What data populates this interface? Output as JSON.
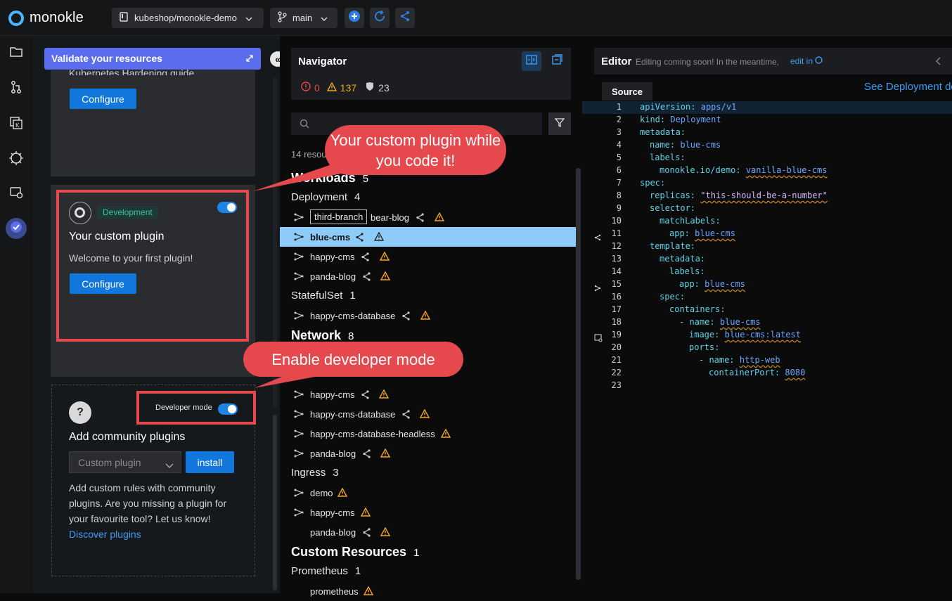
{
  "app": {
    "name": "monokle"
  },
  "topbar": {
    "repo": "kubeshop/monokle-demo",
    "branch": "main"
  },
  "validation": {
    "header": "Validate your resources",
    "card1": {
      "hardening_text": "Kubernetes Hardening guide.",
      "configure_label": "Configure"
    },
    "card2": {
      "badge": "Development",
      "title": "Your custom plugin",
      "description": "Welcome to your first plugin!",
      "configure_label": "Configure"
    },
    "community": {
      "dev_mode_label": "Developer mode",
      "title": "Add community plugins",
      "select_placeholder": "Custom plugin",
      "install_label": "install",
      "description": "Add custom rules with community plugins. Are you missing a plugin for your favourite tool? Let us know!",
      "discover_link": "Discover plugins"
    }
  },
  "navigator": {
    "title": "Navigator",
    "stats": {
      "errors": "0",
      "warnings": "137",
      "policies": "23"
    },
    "resource_count": "14 resources",
    "groups": {
      "workloads": {
        "name": "Workloads",
        "count": "5"
      },
      "network": {
        "name": "Network",
        "count": "8"
      },
      "custom": {
        "name": "Custom Resources",
        "count": "1"
      }
    },
    "kinds": {
      "deployment": {
        "name": "Deployment",
        "count": "4"
      },
      "statefulset": {
        "name": "StatefulSet",
        "count": "1"
      },
      "ingress": {
        "name": "Ingress",
        "count": "3"
      },
      "prometheus": {
        "name": "Prometheus",
        "count": "1"
      }
    },
    "deployment_items": {
      "branch_tag": "third-branch",
      "bear_blog": "bear-blog",
      "blue_cms": "blue-cms",
      "happy_cms": "happy-cms",
      "panda_blog": "panda-blog"
    },
    "statefulset_items": {
      "db": "happy-cms-database"
    },
    "network_items": {
      "happy_cms": "happy-cms",
      "db": "happy-cms-database",
      "db_headless": "happy-cms-database-headless",
      "panda_blog": "panda-blog"
    },
    "ingress_items": {
      "demo": "demo",
      "happy_cms": "happy-cms",
      "panda_blog": "panda-blog"
    },
    "prometheus_items": {
      "prometheus": "prometheus"
    }
  },
  "editor": {
    "title": "Editor",
    "subtitle": "Editing coming soon! In the meantime,",
    "edit_link": "edit in",
    "tab": "Source",
    "see_link": "See Deployment do"
  },
  "code": [
    {
      "n": "1",
      "key": "apiVersion:",
      "val": "apps/v1"
    },
    {
      "n": "2",
      "key": "kind:",
      "val": "Deployment"
    },
    {
      "n": "3",
      "key": "metadata:",
      "val": ""
    },
    {
      "n": "4",
      "key": "name:",
      "val": "blue-cms"
    },
    {
      "n": "5",
      "key": "labels:",
      "val": ""
    },
    {
      "n": "6",
      "key": "monokle.io/demo:",
      "val": "vanilla-blue-cms"
    },
    {
      "n": "7",
      "key": "spec:",
      "val": ""
    },
    {
      "n": "8",
      "key": "replicas:",
      "val": "\"this-should-be-a-number\""
    },
    {
      "n": "9",
      "key": "selector:",
      "val": ""
    },
    {
      "n": "10",
      "key": "matchLabels:",
      "val": ""
    },
    {
      "n": "11",
      "key": "app:",
      "val": "blue-cms"
    },
    {
      "n": "12",
      "key": "template:",
      "val": ""
    },
    {
      "n": "13",
      "key": "metadata:",
      "val": ""
    },
    {
      "n": "14",
      "key": "labels:",
      "val": ""
    },
    {
      "n": "15",
      "key": "app:",
      "val": "blue-cms"
    },
    {
      "n": "16",
      "key": "spec:",
      "val": ""
    },
    {
      "n": "17",
      "key": "containers:",
      "val": ""
    },
    {
      "n": "18",
      "key": "- name:",
      "val": "blue-cms"
    },
    {
      "n": "19",
      "key": "image:",
      "val": "blue-cms:latest"
    },
    {
      "n": "20",
      "key": "ports:",
      "val": ""
    },
    {
      "n": "21",
      "key": "- name:",
      "val": "http-web"
    },
    {
      "n": "22",
      "key": "containerPort:",
      "val": "8080"
    },
    {
      "n": "23",
      "key": "",
      "val": ""
    }
  ],
  "callouts": {
    "plugin": "Your custom plugin while you code it!",
    "devmode": "Enable developer mode"
  }
}
